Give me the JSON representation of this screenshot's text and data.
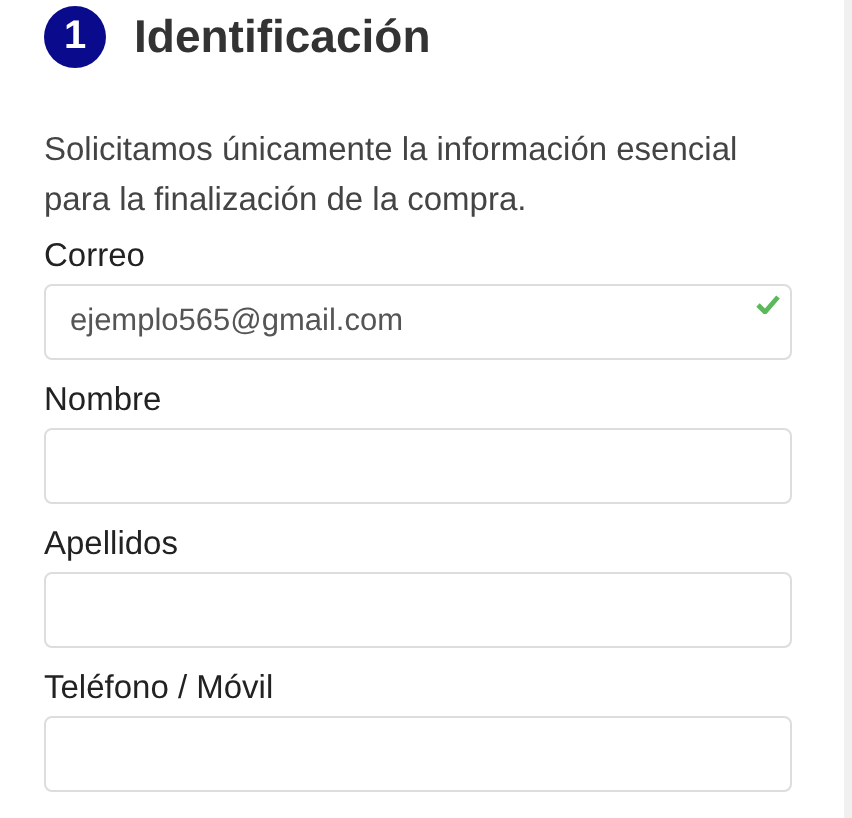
{
  "step": {
    "number": "1",
    "title": "Identificación"
  },
  "description": "Solicitamos únicamente la información esencial para la finalización de la compra.",
  "fields": [
    {
      "label": "Correo",
      "value": "ejemplo565@gmail.com",
      "valid": true
    },
    {
      "label": "Nombre",
      "valid": false
    },
    {
      "label": "Apellidos",
      "valid": false
    },
    {
      "label": "Teléfono / Móvil",
      "valid": false
    }
  ]
}
